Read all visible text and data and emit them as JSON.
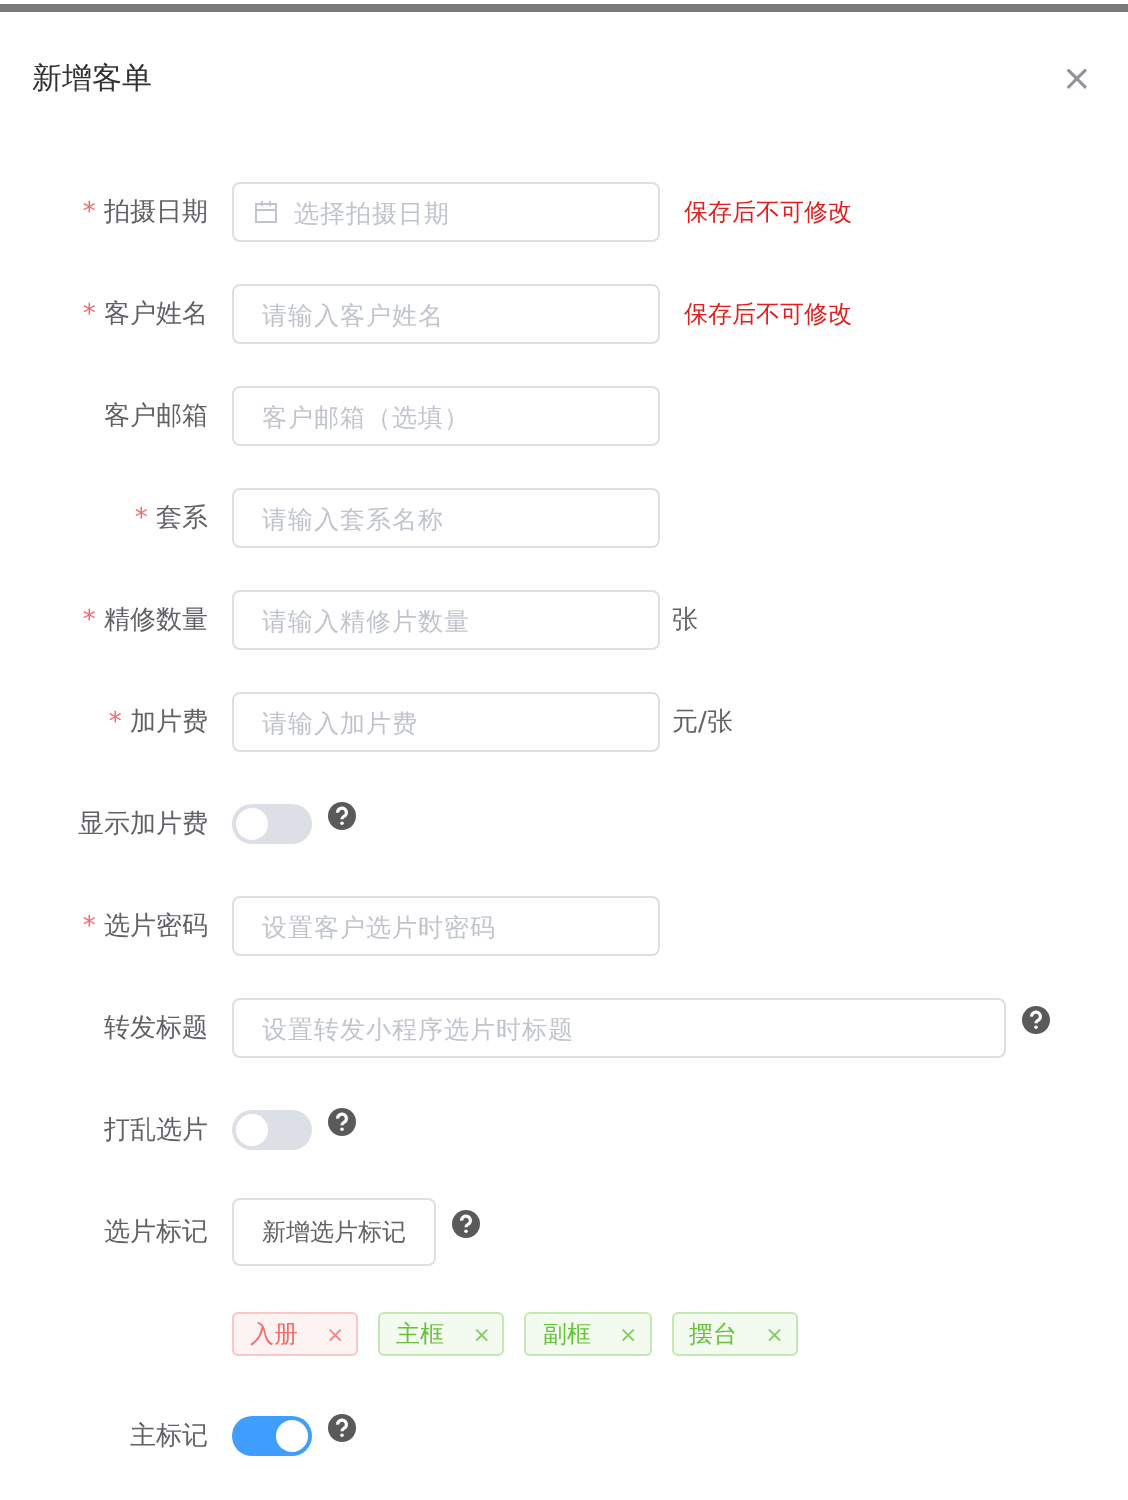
{
  "dialog": {
    "title": "新增客单",
    "close": "×"
  },
  "rows": [
    {
      "kind": "date",
      "label": "拍摄日期",
      "mark": "*",
      "placeholder": "选择拍摄日期",
      "note": "保存后不可修改"
    },
    {
      "kind": "input",
      "label": "客户姓名",
      "mark": "*",
      "placeholder": "请输入客户姓名",
      "note": "保存后不可修改"
    },
    {
      "kind": "input",
      "label": "客户邮箱",
      "placeholder": "客户邮箱（选填）"
    },
    {
      "kind": "input",
      "label": "套系",
      "mark": "*",
      "placeholder": "请输入套系名称"
    },
    {
      "kind": "input",
      "label": "精修数量",
      "mark": "*",
      "placeholder": "请输入精修片数量",
      "suffix": "张"
    },
    {
      "kind": "input",
      "label": "加片费",
      "mark": "*",
      "placeholder": "请输入加片费",
      "suffix": "元/张"
    },
    {
      "kind": "toggle",
      "label": "显示加片费",
      "on": false,
      "help": true
    },
    {
      "kind": "input",
      "label": "选片密码",
      "mark": "*",
      "placeholder": "设置客户选片时密码"
    },
    {
      "kind": "wide",
      "label": "转发标题",
      "placeholder": "设置转发小程序选片时标题",
      "help": true
    },
    {
      "kind": "toggle",
      "label": "打乱选片",
      "on": false,
      "help": true
    },
    {
      "kind": "button",
      "label": "选片标记",
      "button": "新增选片标记",
      "help": true
    },
    {
      "kind": "tags",
      "tags": [
        {
          "text": "入册",
          "color": "#f56c6c",
          "remove": "×"
        },
        {
          "text": "主框",
          "color": "#67c23a",
          "remove": "×"
        },
        {
          "text": "副框",
          "color": "#67c23a",
          "remove": "×"
        },
        {
          "text": "摆台",
          "color": "#67c23a",
          "remove": "×"
        }
      ]
    },
    {
      "kind": "toggle",
      "label": "主标记",
      "on": true,
      "help": true
    }
  ]
}
